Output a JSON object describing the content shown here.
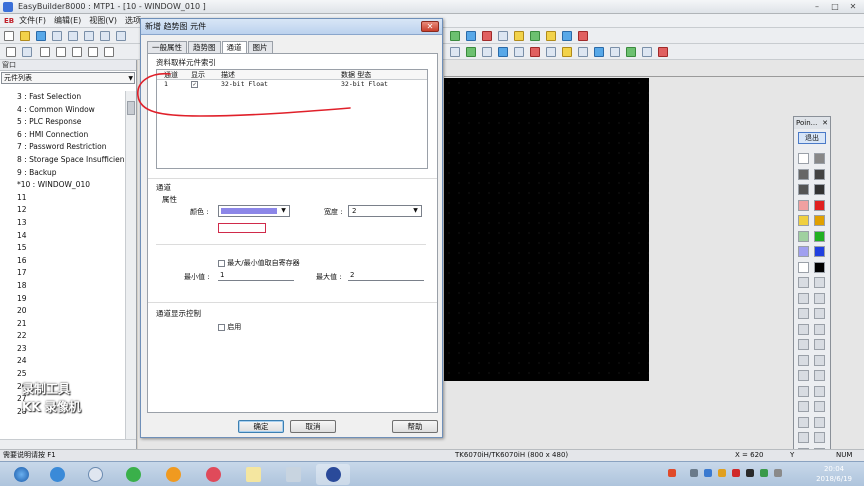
{
  "app": {
    "title": "EasyBuilder8000 : MTP1 - [10 - WINDOW_010 ]",
    "menus": [
      "文件(F)",
      "编辑(E)",
      "视图(V)",
      "选项"
    ],
    "logo": "EB"
  },
  "left_panel": {
    "header": "窗口",
    "combo_value": "元件列表",
    "items": [
      "3 : Fast Selection",
      "4 : Common Window",
      "5 : PLC Response",
      "6 : HMI Connection",
      "7 : Password Restriction",
      "8 : Storage Space Insufficien",
      "9 : Backup",
      "*10 : WINDOW_010",
      "11",
      "12",
      "13",
      "14",
      "15",
      "16",
      "17",
      "18",
      "19",
      "20",
      "21",
      "22",
      "23",
      "24",
      "25",
      "26",
      "27",
      "28"
    ],
    "watermark_line1": "录制工具",
    "watermark_line2": "KK 录像机"
  },
  "dialog": {
    "title": "新增 趋势图 元件",
    "close": "✕",
    "tabs": [
      "一般属性",
      "趋势图",
      "通道",
      "图片"
    ],
    "active_tab": 2,
    "source_group": "资料取样元件索引",
    "list_headers": [
      "通道",
      "显示",
      "描述",
      "数据 型态"
    ],
    "list_rows": [
      {
        "channel": "1",
        "show": "✓",
        "desc": "32-bit Float",
        "type": "32-bit Float"
      }
    ],
    "channel_group": "通道",
    "attr_group": "属性",
    "color_label": "颜色 :",
    "width_label": "宽度 :",
    "width_value": "2",
    "minmax_checkbox": "最大/最小值取自寄存器",
    "min_label": "最小值 :",
    "min_value": "1",
    "max_label": "最大值 :",
    "max_value": "2",
    "display_group": "通道显示控制",
    "enable_checkbox": "启用",
    "ok": "确定",
    "cancel": "取消",
    "help": "帮助"
  },
  "palette": {
    "title": "Poin...",
    "close": "✕",
    "exit": "退出"
  },
  "statusbar": {
    "help": "需要说明请按 F1",
    "model": "TK6070iH/TK6070iH (800 x 480)",
    "coords": "X = 620",
    "y": "Y",
    "num": "NUM"
  },
  "taskbar": {
    "time": "20:04",
    "date": "2018/6/19"
  },
  "colors": {
    "annotation": "#e0202a",
    "canvas": "#000000",
    "channel_color": "#8c86e8"
  }
}
